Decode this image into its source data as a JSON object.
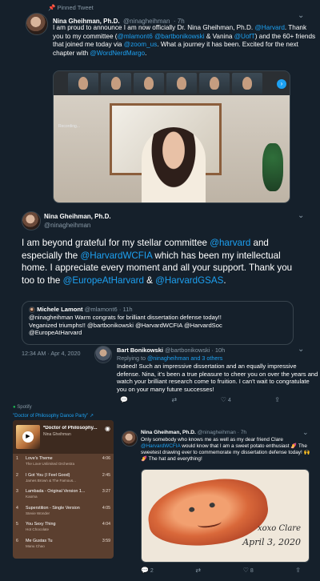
{
  "pinned": {
    "label": "Pinned Tweet",
    "name": "Nina Gheihman, Ph.D.",
    "handle": "@ninagheihman",
    "time": "· 7h",
    "text_parts": [
      "I am proud to announce I am now officially Dr. Nina Gheihman, Ph.D. ",
      "@Harvard",
      ". Thank you to my committee (",
      "@mlamont6 @bartbonikowski",
      " & Vanina ",
      "@UofT",
      ") and the 60+ friends that joined me today via ",
      "@zoom_us",
      ". What a journey it has been. Excited for the next chapter with ",
      "@WordNerdMargo",
      "."
    ],
    "video_recording_label": "Recording..."
  },
  "main_tweet": {
    "name": "Nina Gheihman, Ph.D.",
    "handle": "@ninagheihman",
    "text_parts": [
      "I am beyond grateful for my stellar committee ",
      "@harvard",
      " and especially the ",
      "@HarvardWCFIA",
      " which has been my intellectual home. I appreciate every moment and all your support. Thank you too to the ",
      "@EuropeAtHarvard",
      " & ",
      "@HarvardGSAS",
      "."
    ],
    "quoted": {
      "name": "Michele Lamont",
      "handle": "@mlamont6",
      "time": "· 11h",
      "line1": "@ninagheihman Warm congrats for brilliant dissertation defense today!!",
      "line2": "Veganized triumphs!! @bartbonikowski @HarvardWCFIA @HarvardSoc",
      "line3": "@EuropeAtHarvard"
    },
    "timestamp": "12:34 AM · Apr 4, 2020"
  },
  "reply": {
    "name": "Bart Bonikowski",
    "handle": "@bartbonikowski",
    "time": "· 10h",
    "replying_prefix": "Replying to ",
    "replying_users": "@ninagheihman and 3 others",
    "text": "Indeed! Such an impressive dissertation and an equally impressive defense. Nina, it's been a true pleasure to cheer you on over the years and watch your brilliant research come to fruition. I can't wait to congratulate you on your many future successes!",
    "likes": "4"
  },
  "spotify": {
    "source": "Spotify",
    "playlist_link": "\"Doctor of Philosophy Dance Party\" ↗",
    "playlist_title": "*Doctor of Philosophy...",
    "owner": "Nina Gheihman",
    "tracks": [
      {
        "num": "1",
        "title": "Love's Theme",
        "artist": "The Love Unlimited Orchestra",
        "dur": "4:06"
      },
      {
        "num": "2",
        "title": "I Got You (I Feel Good)",
        "artist": "James Brown & The Famous...",
        "dur": "2:45"
      },
      {
        "num": "3",
        "title": "Lambada - Original Version 1...",
        "artist": "Kaoma",
        "dur": "3:27"
      },
      {
        "num": "4",
        "title": "Superstition - Single Version",
        "artist": "Stevie Wonder",
        "dur": "4:05"
      },
      {
        "num": "5",
        "title": "You Sexy Thing",
        "artist": "Hot Chocolate",
        "dur": "4:04"
      },
      {
        "num": "6",
        "title": "Me Gustas Tu",
        "artist": "Manu Chao",
        "dur": "3:59"
      }
    ]
  },
  "last_tweet": {
    "name": "Nina Gheihman, Ph.D.",
    "handle": "@ninagheihman",
    "time": "· 7h",
    "line1": "Only somebody who knows me as well as my dear friend Clare",
    "line2_mention": "@HarvardWCFIA",
    "line2_rest": " would know that I am a sweet potato enthusiast 🍠 The",
    "line3": "sweetest drawing ever to commemorate my dissertation defense today! 🙌",
    "line4": "🍠 The hat and everything!",
    "drawing_sign1": "xoxo Clare",
    "drawing_sign2": "April 3, 2020",
    "retweets": "2",
    "likes": "8"
  },
  "colors": {
    "background": "#15202b",
    "link": "#1da1f2",
    "muted": "#8899a6"
  }
}
